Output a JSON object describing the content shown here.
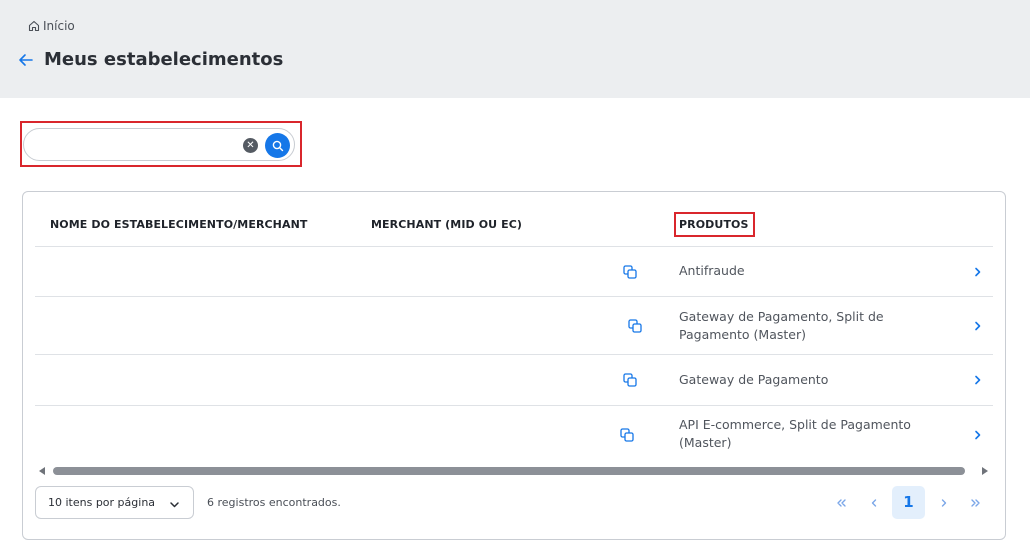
{
  "breadcrumb": {
    "home_label": "Início"
  },
  "page": {
    "title": "Meus estabelecimentos"
  },
  "search": {
    "value": "",
    "placeholder": ""
  },
  "table": {
    "columns": [
      "NOME DO ESTABELECIMENTO/MERCHANT",
      "MERCHANT (MID OU EC)",
      "PRODUTOS"
    ],
    "rows": [
      {
        "name": "",
        "merchant": "",
        "products_line1": "Antifraude",
        "products_line2": ""
      },
      {
        "name": "",
        "merchant": "",
        "products_line1": "Gateway de Pagamento, Split de",
        "products_line2": "Pagamento (Master)"
      },
      {
        "name": "",
        "merchant": "",
        "products_line1": "Gateway de Pagamento",
        "products_line2": ""
      },
      {
        "name": "",
        "merchant": "",
        "products_line1": "API E-commerce, Split de Pagamento",
        "products_line2": "(Master)"
      }
    ]
  },
  "footer": {
    "per_page": "10 itens por página",
    "records": "6 registros encontrados.",
    "current_page": "1"
  },
  "icons": {
    "home": "home-icon",
    "back": "arrow-left-icon",
    "clear": "close-circle-icon",
    "search": "search-icon",
    "copy": "copy-icon",
    "row_open": "chevron-right-icon",
    "select": "chevron-down-icon",
    "first": "double-chevron-left-icon",
    "prev": "chevron-left-icon",
    "next": "chevron-right-icon",
    "last": "double-chevron-right-icon"
  },
  "colors": {
    "accent": "#1677e8",
    "highlight": "#d9262c",
    "header_bg": "#eceef0"
  }
}
